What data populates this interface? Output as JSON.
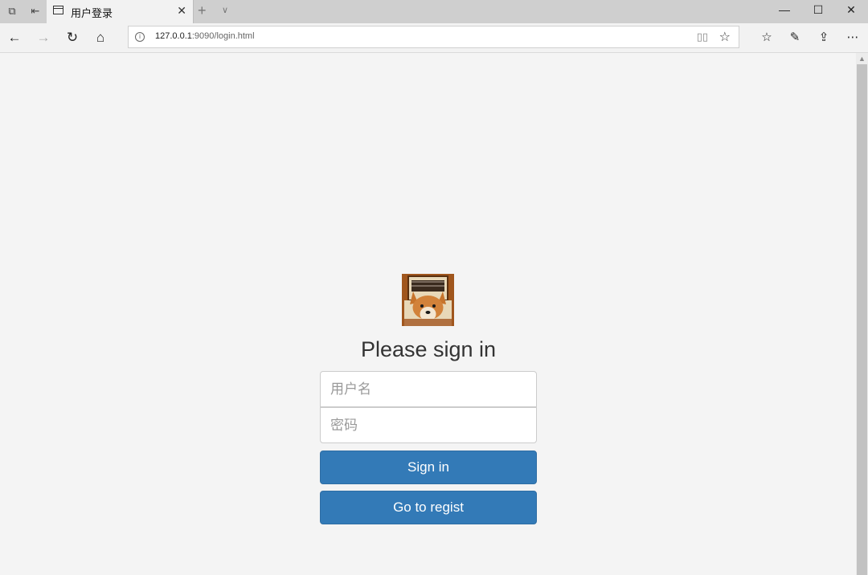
{
  "browser": {
    "tab_title": "用户登录",
    "url_host": "127.0.0.1",
    "url_rest": ":9090/login.html"
  },
  "login": {
    "heading": "Please sign in",
    "username_placeholder": "用户名",
    "password_placeholder": "密码",
    "signin_label": "Sign in",
    "regist_label": "Go to regist"
  },
  "colors": {
    "primary": "#337ab7",
    "page_bg": "#f4f4f4"
  }
}
